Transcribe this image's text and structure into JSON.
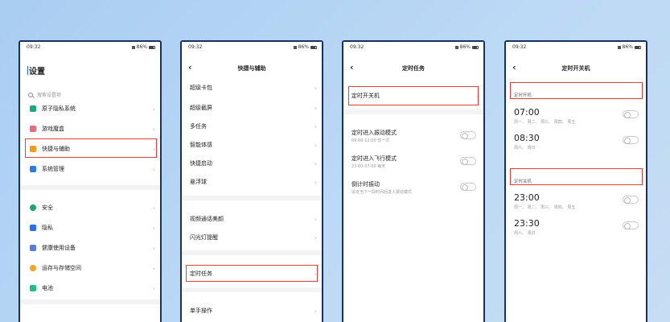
{
  "status": {
    "time": "09:32",
    "battery": "86%"
  },
  "settings": {
    "title": "设置",
    "search_placeholder": "搜索设置项",
    "items": [
      {
        "label": "原子隐私系统",
        "icon": "shield-icon",
        "color": "#1aa87c"
      },
      {
        "label": "游戏魔盒",
        "icon": "gamepad-icon",
        "color": "#e86a7b"
      },
      {
        "label": "快捷与辅助",
        "icon": "arrow-right-icon",
        "color": "#f39a1f"
      },
      {
        "label": "系统管理",
        "icon": "gear-icon",
        "color": "#2a7de1"
      },
      {
        "label": "安全",
        "icon": "security-shield-icon",
        "color": "#18a86a"
      },
      {
        "label": "隐私",
        "icon": "lock-icon",
        "color": "#2a6df4"
      },
      {
        "label": "健康使用设备",
        "icon": "hourglass-icon",
        "color": "#5a7bd8"
      },
      {
        "label": "运存与存储空间",
        "icon": "pie-icon",
        "color": "#f5a623"
      },
      {
        "label": "电池",
        "icon": "battery-icon",
        "color": "#1dbf87"
      }
    ]
  },
  "shortcut": {
    "title": "快捷与辅助",
    "items_a": [
      "超级卡包",
      "超级截屏",
      "多任务",
      "智能体感",
      "快捷启动",
      "悬浮球"
    ],
    "items_b": [
      "视频通话美颜",
      "闪光灯提醒"
    ],
    "items_c": [
      "定时任务"
    ],
    "items_d": [
      "单手操作"
    ]
  },
  "scheduled": {
    "title": "定时任务",
    "power_item": "定时开关机",
    "toggles": [
      {
        "title": "定时进入振动模式",
        "sub": "09:00-12:00 仅一次"
      },
      {
        "title": "定时进入飞行模式",
        "sub": "23:00-07:00 每天"
      },
      {
        "title": "倒计时振动",
        "sub": "设定当下一段时间后进入振动模式"
      }
    ]
  },
  "power": {
    "title": "定时开关机",
    "on_label": "定时开机",
    "off_label": "定时关机",
    "on_times": [
      {
        "time": "07:00",
        "days": "周一、 周二、 周三、 周四、 周五"
      },
      {
        "time": "08:30",
        "days": "周六、 周日"
      }
    ],
    "off_times": [
      {
        "time": "23:00",
        "days": "周一、 周二、 周三、 周四、 周五"
      },
      {
        "time": "23:30",
        "days": "周六、 周日"
      }
    ]
  },
  "colors": {
    "highlight": "#e0413a",
    "frame": "#17325c",
    "accent": "#2a6df4"
  }
}
